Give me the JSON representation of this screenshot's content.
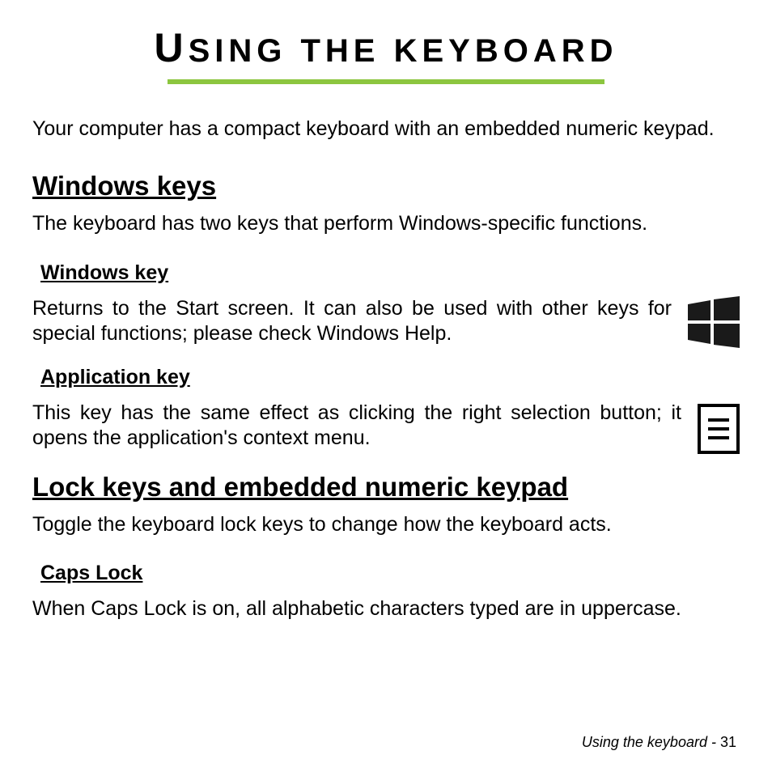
{
  "title_cap": "U",
  "title_rest": "SING THE KEYBOARD",
  "intro": "Your computer has a compact keyboard with an embedded numeric keypad.",
  "sections": {
    "windows_keys": {
      "heading": "Windows keys",
      "text": "The keyboard has two keys that perform Windows-specific functions.",
      "windows_key": {
        "heading": "Windows key",
        "text": "Returns to the Start screen. It can also be used with other keys for special functions; please check Windows Help."
      },
      "application_key": {
        "heading": "Application key",
        "text": "This key has the same effect as clicking the right selection button; it opens the application's context menu."
      }
    },
    "lock_keys": {
      "heading": "Lock keys and embedded numeric keypad",
      "text": "Toggle the keyboard lock keys to change how the keyboard acts.",
      "caps_lock": {
        "heading": "Caps Lock",
        "text": "When Caps Lock is on, all alphabetic characters typed are in uppercase."
      }
    }
  },
  "footer": {
    "label": "Using the keyboard -  ",
    "page": "31"
  }
}
